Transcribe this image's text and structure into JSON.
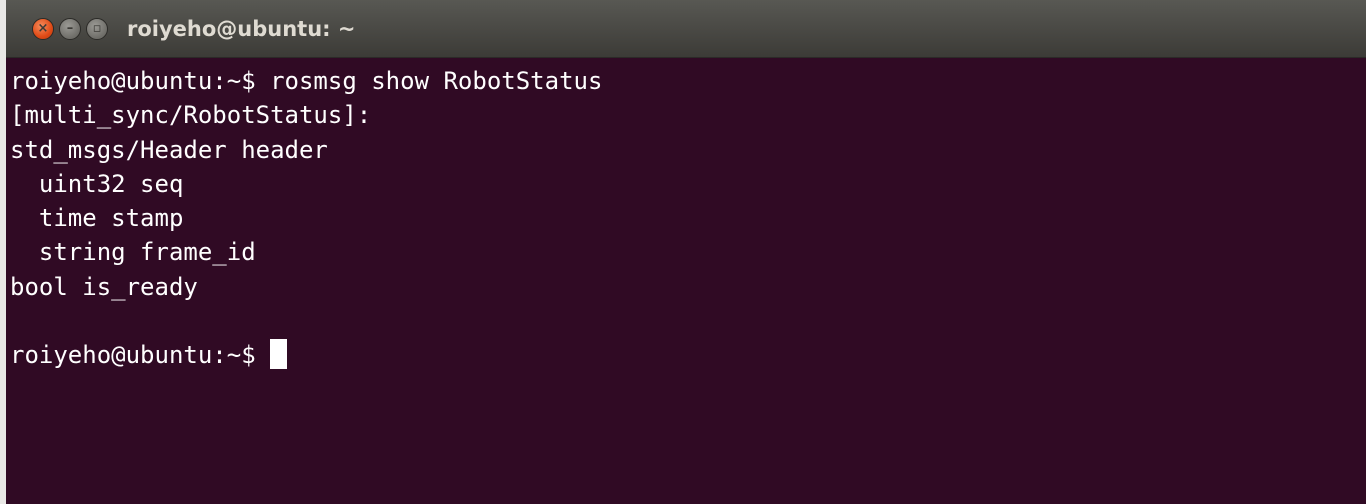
{
  "window": {
    "title": "roiyeho@ubuntu: ~",
    "buttons": {
      "close": "×",
      "minimize": "–",
      "maximize": "▫"
    }
  },
  "terminal": {
    "lines": [
      "roiyeho@ubuntu:~$ rosmsg show RobotStatus",
      "[multi_sync/RobotStatus]:",
      "std_msgs/Header header",
      "  uint32 seq",
      "  time stamp",
      "  string frame_id",
      "bool is_ready",
      ""
    ],
    "prompt": "roiyeho@ubuntu:~$ ",
    "colors": {
      "background": "#300a24",
      "foreground": "#ffffff",
      "titlebar": "#3c3b37",
      "close_button": "#df4a16"
    }
  }
}
